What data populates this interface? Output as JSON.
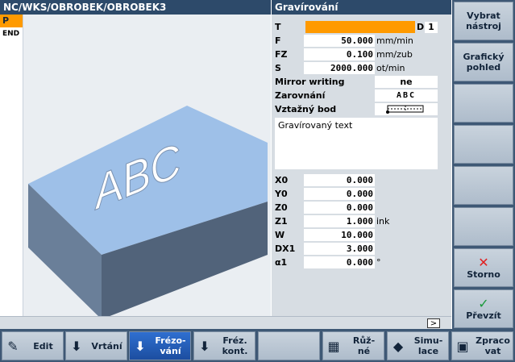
{
  "header": {
    "path": "NC/WKS/OBROBEK/OBROBEK3",
    "form_title": "Gravírování"
  },
  "program_list": [
    {
      "label": "P",
      "active": true
    },
    {
      "label": "END",
      "active": false
    }
  ],
  "graphic": {
    "engraved_text": "ABC"
  },
  "form": {
    "tool": {
      "label": "T",
      "value": "",
      "d_label": "D",
      "d_value": "1"
    },
    "feed": [
      {
        "label": "F",
        "value": "50.000",
        "unit": "mm/min"
      },
      {
        "label": "FZ",
        "value": "0.100",
        "unit": "mm/zub"
      },
      {
        "label": "S",
        "value": "2000.000",
        "unit": "ot/min"
      }
    ],
    "mirror": {
      "label": "Mirror writing",
      "value": "ne"
    },
    "align": {
      "label": "Zarovnání",
      "value": "ABC"
    },
    "ref_point": {
      "label": "Vztažný bod"
    },
    "text_value": "Gravírovaný text",
    "coords": [
      {
        "label": "X0",
        "value": "0.000",
        "unit": ""
      },
      {
        "label": "Y0",
        "value": "0.000",
        "unit": ""
      },
      {
        "label": "Z0",
        "value": "0.000",
        "unit": ""
      },
      {
        "label": "Z1",
        "value": "1.000",
        "unit": "ink"
      },
      {
        "label": "W",
        "value": "10.000",
        "unit": ""
      },
      {
        "label": "DX1",
        "value": "3.000",
        "unit": ""
      },
      {
        "label": "α1",
        "value": "0.000",
        "unit": "°"
      }
    ]
  },
  "scroll": {
    "arrow": ">"
  },
  "vertical_softkeys": [
    {
      "label": "Vybrat\nnástroj",
      "icon": ""
    },
    {
      "label": "Grafický\npohled",
      "icon": ""
    },
    {
      "label": "",
      "icon": ""
    },
    {
      "label": "",
      "icon": ""
    },
    {
      "label": "",
      "icon": ""
    },
    {
      "label": "",
      "icon": ""
    },
    {
      "label": "Storno",
      "icon": "✕"
    },
    {
      "label": "Převzít",
      "icon": "✓"
    }
  ],
  "horizontal_softkeys": [
    {
      "label": "Edit",
      "icon": "edit-icon",
      "active": false
    },
    {
      "label": "Vrtání",
      "icon": "drill-icon",
      "active": false
    },
    {
      "label": "Frézo-\nvání",
      "icon": "mill-icon",
      "active": true
    },
    {
      "label": "Fréz.\nkont.",
      "icon": "contour-icon",
      "active": false
    },
    {
      "label": "",
      "icon": "",
      "active": false
    },
    {
      "label": "Růž-\nné",
      "icon": "misc-icon",
      "active": false
    },
    {
      "label": "Simu-\nlace",
      "icon": "simulate-icon",
      "active": false
    },
    {
      "label": "Zpraco\nvat",
      "icon": "nc-icon",
      "active": false
    }
  ],
  "colors": {
    "accent": "#ff9a00",
    "title_bar": "#2d4a6a",
    "active_key": "#2f6fd0",
    "cancel": "#e02020",
    "ok": "#1a9a3a"
  }
}
